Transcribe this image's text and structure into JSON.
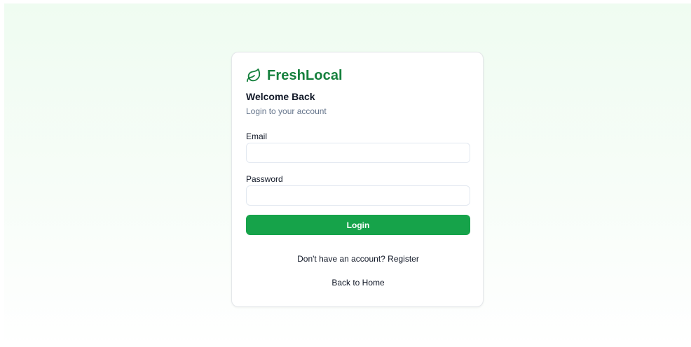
{
  "brand": {
    "name": "FreshLocal",
    "icon": "leaf-icon",
    "color": "#15803d"
  },
  "login": {
    "title": "Welcome Back",
    "subtitle": "Login to your account",
    "email_label": "Email",
    "email_value": "",
    "password_label": "Password",
    "password_value": "",
    "submit_label": "Login",
    "button_color": "#16a34a"
  },
  "links": {
    "register": "Don't have an account? Register",
    "home": "Back to Home"
  }
}
